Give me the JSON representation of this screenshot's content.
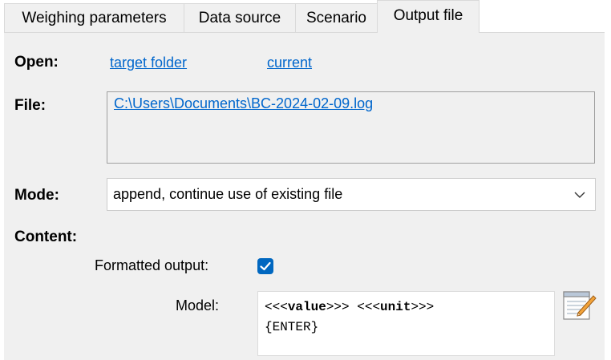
{
  "tabs": [
    {
      "label": "Weighing parameters",
      "active": false
    },
    {
      "label": "Data source",
      "active": false
    },
    {
      "label": "Scenario",
      "active": false
    },
    {
      "label": "Output file",
      "active": true
    }
  ],
  "open": {
    "label": "Open:",
    "target_folder_link": "target folder",
    "current_link": "current "
  },
  "file": {
    "label": "File:",
    "path": "C:\\Users\\Documents\\BC-2024-02-09.log"
  },
  "mode": {
    "label": "Mode:",
    "selected": "append, continue use of existing file"
  },
  "content": {
    "label": "Content:",
    "formatted_output_label": "Formatted output:",
    "formatted_output_checked": true,
    "model_label": "Model:",
    "model_line1_pre": "<<<",
    "model_line1_value": "value",
    "model_line1_mid": ">>> <<<",
    "model_line1_unit": "unit",
    "model_line1_post": ">>>",
    "model_line2": "{ENTER}"
  },
  "colors": {
    "link": "#0066cc",
    "checkbox": "#0067c0",
    "panel_bg": "#f0f0f0"
  },
  "icons": {
    "dropdown": "chevron-down-icon",
    "checkmark": "checkmark-icon",
    "edit": "notepad-pencil-icon"
  }
}
